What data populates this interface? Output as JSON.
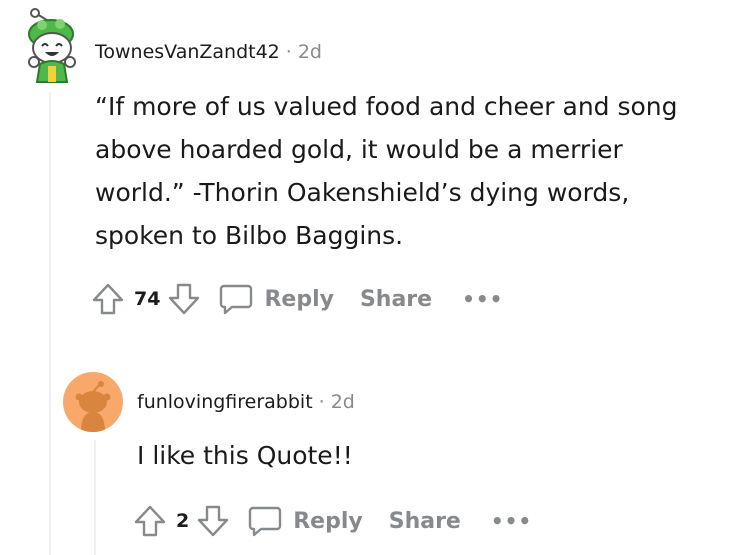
{
  "comments": [
    {
      "username": "TownesVanZandt42",
      "separator": "·",
      "time": "2d",
      "body": [
        "“If more of us valued food and cheer and song",
        "above hoarded gold, it would be a merrier",
        "world.” -Thorin Oakenshield’s dying words,",
        "spoken to Bilbo Baggins."
      ],
      "score": "74",
      "reply_label": "Reply",
      "share_label": "Share",
      "more_label": "•••",
      "avatar_icon": "snoo-green-hat-avatar-icon"
    },
    {
      "username": "funlovingfirerabbit",
      "separator": "·",
      "time": "2d",
      "body": [
        "I like this Quote!!"
      ],
      "score": "2",
      "reply_label": "Reply",
      "share_label": "Share",
      "more_label": "•••",
      "avatar_icon": "default-orange-snoo-avatar-icon"
    }
  ],
  "colors": {
    "meta_gray": "#878a8c",
    "avatar_orange": "#f7a86a",
    "avatar_green": "#4fb84a",
    "thread_line": "#edeff1"
  }
}
